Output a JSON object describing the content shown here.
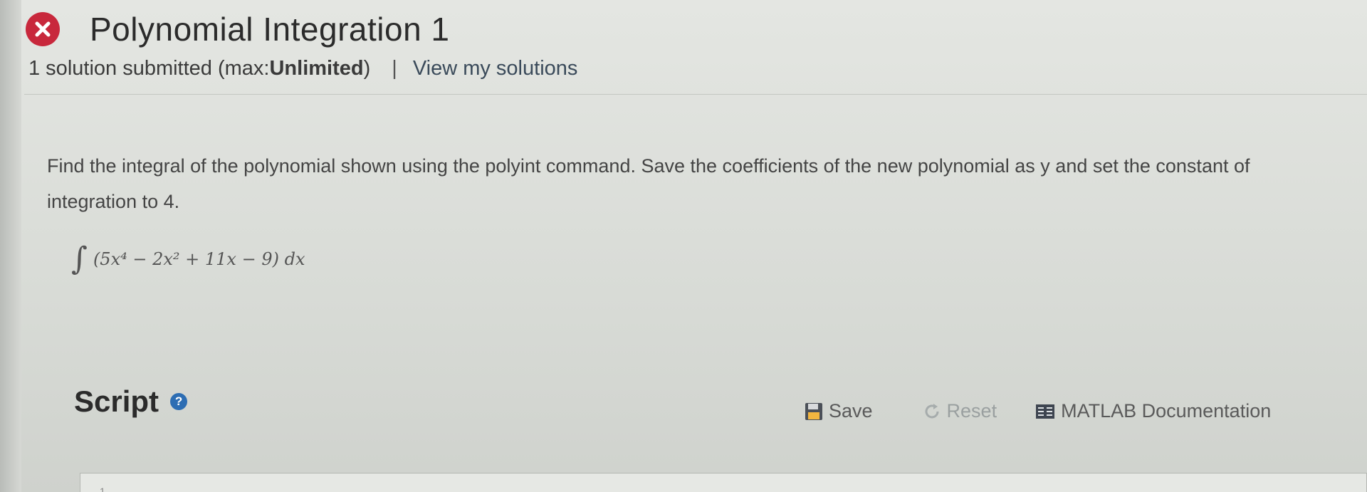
{
  "problem": {
    "title": "Polynomial Integration 1",
    "status_icon": "x-circle-icon",
    "status_color": "#c8283c"
  },
  "submission": {
    "count_text": "1 solution submitted (max: ",
    "max_value": "Unlimited",
    "count_close": ")",
    "separator": "|",
    "view_link": "View my solutions"
  },
  "description": {
    "text": "Find the integral of the polynomial shown using the polyint command. Save the coefficients of the new polynomial as y and set the constant of integration to 4."
  },
  "formula": {
    "integral": "∫",
    "expression": "(5x⁴ − 2x² + 11x − 9) dx"
  },
  "script": {
    "label": "Script",
    "help_icon": "question-circle-icon",
    "help_glyph": "?"
  },
  "toolbar": {
    "save_label": "Save",
    "save_icon": "floppy-disk-icon",
    "reset_label": "Reset",
    "reset_icon": "refresh-icon",
    "docs_label": "MATLAB Documentation",
    "docs_icon": "documentation-icon"
  },
  "editor": {
    "line_number": "1"
  }
}
